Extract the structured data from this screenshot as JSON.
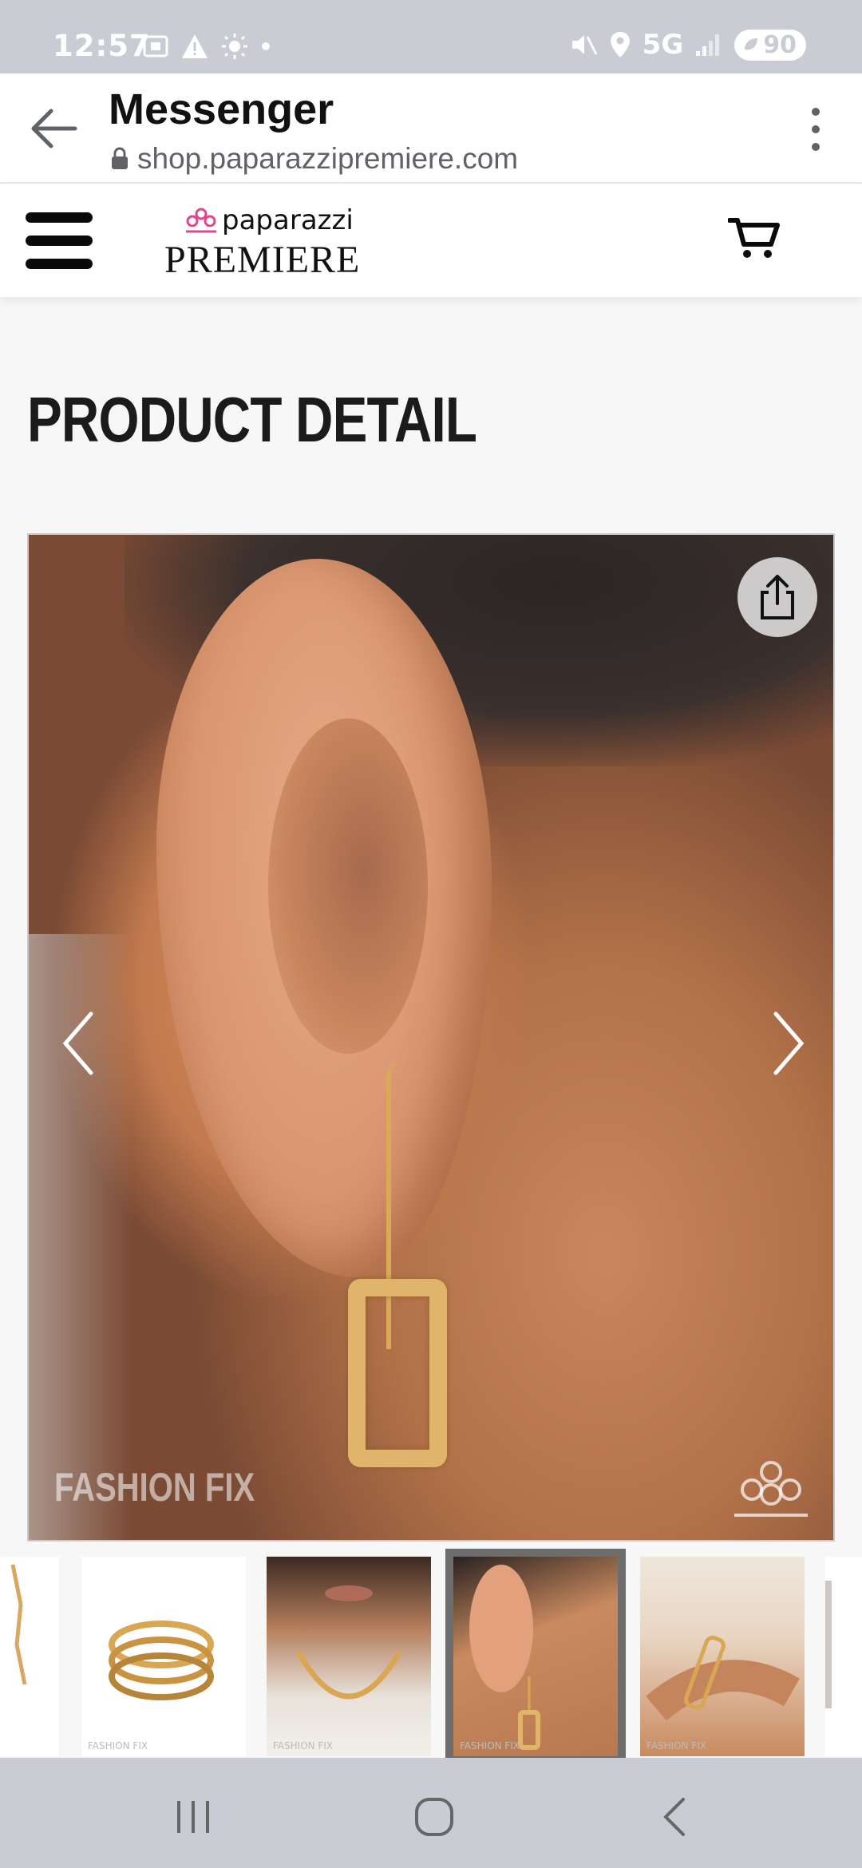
{
  "status_bar": {
    "time": "12:57",
    "network": "5G",
    "battery": "90"
  },
  "browser": {
    "title": "Messenger",
    "url": "shop.paparazzipremiere.com"
  },
  "site": {
    "brand_top": "paparazzi",
    "brand_main": "PREMIERE"
  },
  "page": {
    "title": "PRODUCT DETAIL"
  },
  "gallery": {
    "watermark": "FASHION FIX"
  },
  "thumbnails": {
    "caption": "FASHION FIX"
  },
  "colors": {
    "accent_pink": "#e0478f",
    "selected_outline": "#6d6d6d",
    "gold": "#e0b56b"
  }
}
